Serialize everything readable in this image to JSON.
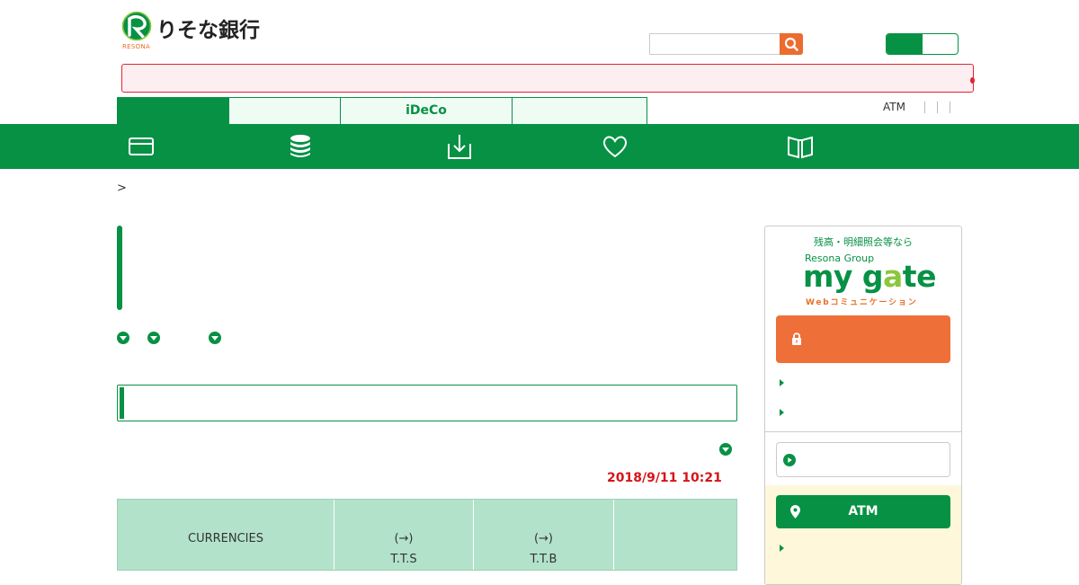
{
  "header": {
    "logo_text": "りそな銀行",
    "logo_sub": "RESONA",
    "search": {
      "placeholder": "",
      "icon": "search-icon"
    },
    "colors": {
      "brand_green": "#079145",
      "accent_orange": "#ec6b2f",
      "alert_red": "#e0242f"
    }
  },
  "tabs": [
    {
      "label": "",
      "active": true
    },
    {
      "label": "",
      "active": false
    },
    {
      "label": "iDeCo",
      "active": false
    },
    {
      "label": "",
      "active": false
    }
  ],
  "utility_links": {
    "atm": "ATM"
  },
  "main_nav": {
    "icons": [
      "card-icon",
      "coins-icon",
      "download-icon",
      "heart-icon",
      "book-icon"
    ]
  },
  "breadcrumb": {
    "separator": ">"
  },
  "rates": {
    "timestamp": "2018/9/11 10:21",
    "table_headers": [
      {
        "line1": "CURRENCIES",
        "line2": ""
      },
      {
        "line1": "(→)",
        "line2": "T.T.S"
      },
      {
        "line1": "(→)",
        "line2": "T.T.B"
      },
      {
        "line1": "",
        "line2": ""
      }
    ]
  },
  "sidebar": {
    "mygate": {
      "caption": "残高・明細照会等なら",
      "group": "Resona Group",
      "logo_my": "my g",
      "logo_a": "a",
      "logo_te": "te",
      "sub": "Webコミュニケーション"
    },
    "atm_button": "ATM"
  }
}
